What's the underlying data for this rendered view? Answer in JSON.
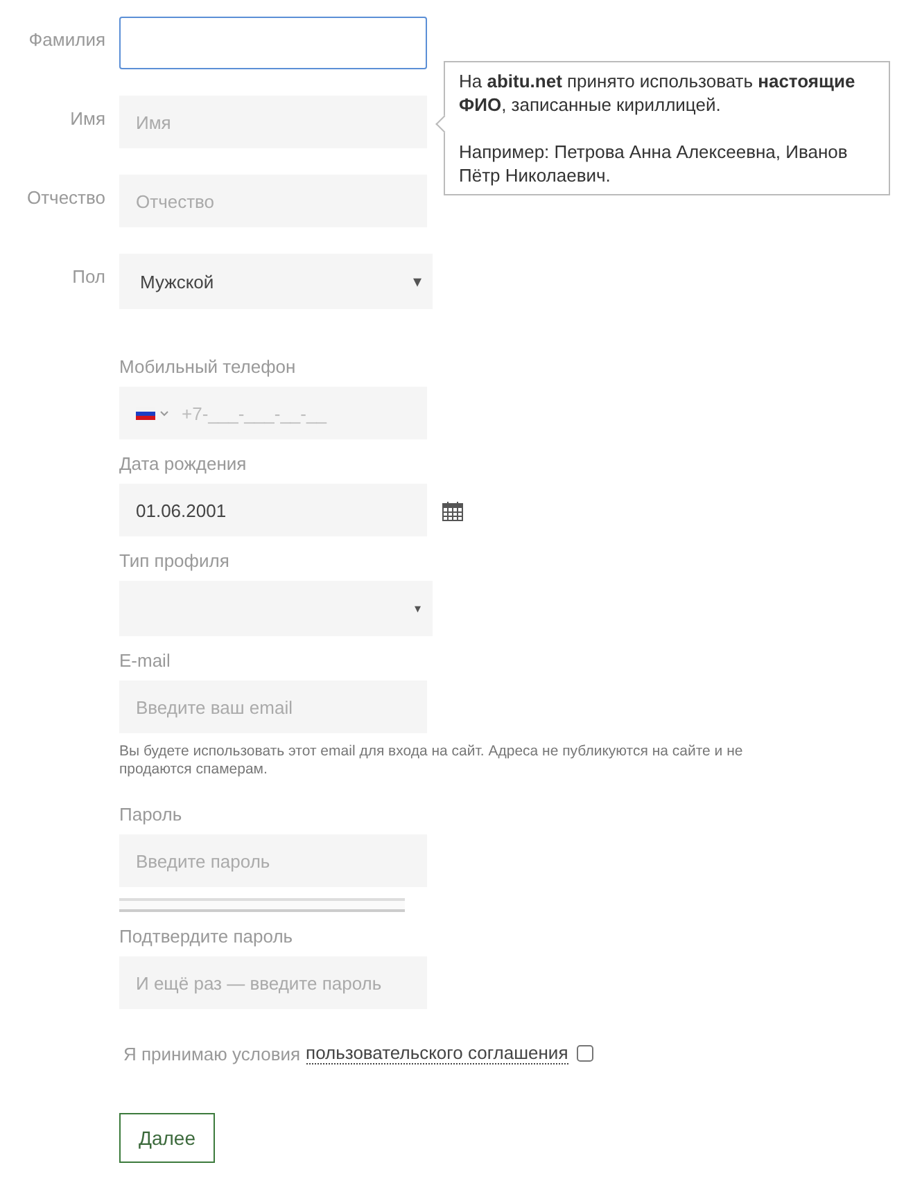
{
  "top_fields": [
    {
      "kind": "text",
      "label": "Фамилия",
      "focused": true
    },
    {
      "kind": "text",
      "label": "Имя",
      "placeholder": "Имя",
      "focused": false
    },
    {
      "kind": "text",
      "label": "Отчество",
      "placeholder": "Отчество",
      "focused": false
    },
    {
      "kind": "select",
      "label": "Пол",
      "value": "Мужской",
      "arrow": "▾",
      "focused": false
    }
  ],
  "tooltip": {
    "paragraphs": [
      "На **abitu.net** принято использовать **настоящие ФИО**, записанные кириллицей.",
      "Например: Петрова Анна Алексеевна, Иванов Пётр Николаевич."
    ]
  },
  "fields": [
    {
      "kind": "phone",
      "label": "Мобильный телефон",
      "placeholder": "+7-___-___-__-__"
    },
    {
      "kind": "date",
      "label": "Дата рождения",
      "value": "01.06.2001"
    },
    {
      "kind": "select",
      "label": "Тип профиля",
      "arrow": "▾"
    },
    {
      "kind": "text",
      "label": "E-mail",
      "placeholder": "Введите ваш email",
      "hint": "Вы будете использовать этот email для входа на сайт. Адреса не публикуются на сайте и не продаются спамерам."
    },
    {
      "kind": "password",
      "label": "Пароль",
      "placeholder": "Введите пароль",
      "level": 0
    },
    {
      "kind": "text",
      "label": "Подтвердите пароль",
      "placeholder": "И ещё раз — введите пароль"
    }
  ],
  "agreement": {
    "text": "Я принимаю условия",
    "link": "пользовательского соглашения",
    "checked": false
  },
  "button": "Далее"
}
